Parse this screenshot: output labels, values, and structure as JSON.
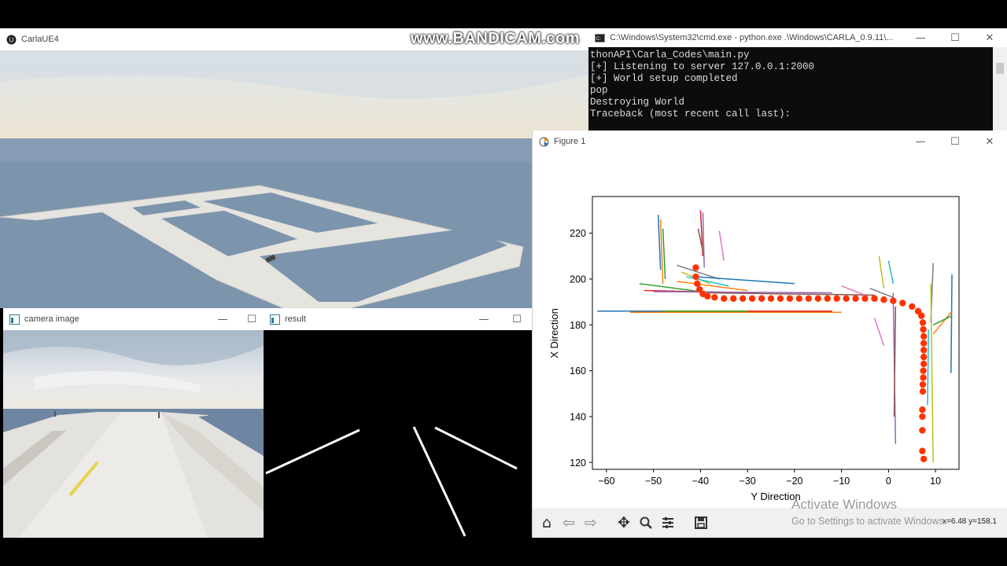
{
  "carla_window": {
    "title": "CarlaUE4",
    "minimize": "—",
    "maximize": "☐",
    "close": "✕"
  },
  "cmd_window": {
    "title": "C:\\Windows\\System32\\cmd.exe - python.exe  .\\Windows\\CARLA_0.9.11\\...",
    "minimize": "—",
    "maximize": "☐",
    "close": "✕",
    "lines": [
      "thonAPI\\Carla_Codes\\main.py",
      "[+] Listening to server 127.0.0.1:2000",
      "[+] World setup completed",
      "pop",
      "Destroying World",
      "Traceback (most recent call last):"
    ]
  },
  "camera_window": {
    "title": "camera image",
    "minimize": "—",
    "maximize": "☐"
  },
  "result_window": {
    "title": "result",
    "minimize": "—",
    "maximize": "☐"
  },
  "figure_window": {
    "title": "Figure 1",
    "minimize": "—",
    "maximize": "☐",
    "close": "✕",
    "toolbar": {
      "home": "home-icon",
      "back": "back-arrow-icon",
      "forward": "forward-arrow-icon",
      "pan": "pan-icon",
      "zoom": "zoom-icon",
      "configure": "configure-icon",
      "save": "save-icon"
    },
    "coords": "x=6.48 y=158.1"
  },
  "chart_data": {
    "type": "scatter",
    "title": "",
    "xlabel": "Y Direction",
    "ylabel": "X Direction",
    "xlim": [
      -63,
      15
    ],
    "ylim": [
      117,
      236
    ],
    "xticks": [
      -60,
      -50,
      -40,
      -30,
      -20,
      -10,
      0,
      10
    ],
    "yticks": [
      120,
      140,
      160,
      180,
      200,
      220
    ],
    "grid": false,
    "series": [
      {
        "marker_color": "#ff3300",
        "points": [
          [
            -41,
            205
          ],
          [
            -41,
            201
          ],
          [
            -40.7,
            198
          ],
          [
            -40.2,
            195.5
          ],
          [
            -39.5,
            193.5
          ],
          [
            -38.5,
            192.5
          ],
          [
            -37,
            192
          ],
          [
            -35,
            191.5
          ],
          [
            -33,
            191.5
          ],
          [
            -31,
            191.5
          ],
          [
            -29,
            191.5
          ],
          [
            -27,
            191.5
          ],
          [
            -25,
            191.5
          ],
          [
            -23,
            191.5
          ],
          [
            -21,
            191.5
          ],
          [
            -19,
            191.5
          ],
          [
            -17,
            191.5
          ],
          [
            -15,
            191.5
          ],
          [
            -13,
            191.5
          ],
          [
            -11,
            191.5
          ],
          [
            -9,
            191.5
          ],
          [
            -7,
            191.5
          ],
          [
            -5,
            191.5
          ],
          [
            -3,
            191.5
          ],
          [
            -1,
            191
          ],
          [
            1,
            190.5
          ],
          [
            3,
            189.5
          ],
          [
            5,
            188
          ],
          [
            6.3,
            186
          ],
          [
            7,
            184
          ],
          [
            7.3,
            181
          ],
          [
            7.4,
            178
          ],
          [
            7.5,
            175
          ],
          [
            7.5,
            172
          ],
          [
            7.5,
            169
          ],
          [
            7.5,
            166
          ],
          [
            7.5,
            163
          ],
          [
            7.4,
            160
          ],
          [
            7.4,
            157
          ],
          [
            7.3,
            154
          ],
          [
            7.3,
            151
          ],
          [
            7.2,
            143
          ],
          [
            7.2,
            140
          ],
          [
            7.2,
            134
          ],
          [
            7.2,
            125
          ],
          [
            7.5,
            121.5
          ]
        ]
      }
    ],
    "line_colors": [
      "#1f77b4",
      "#ff7f0e",
      "#2ca02c",
      "#d62728",
      "#9467bd",
      "#8c564b",
      "#e377c2",
      "#7f7f7f",
      "#bcbd22",
      "#17becf"
    ],
    "line_segments": [
      [
        [
          -49,
          228
        ],
        [
          -48.5,
          204
        ]
      ],
      [
        [
          -48.5,
          226
        ],
        [
          -48,
          198
        ]
      ],
      [
        [
          -48,
          222
        ],
        [
          -47.5,
          200
        ]
      ],
      [
        [
          -40,
          230
        ],
        [
          -39.5,
          210
        ]
      ],
      [
        [
          -39.5,
          229
        ],
        [
          -39.2,
          205
        ]
      ],
      [
        [
          -40.5,
          222
        ],
        [
          -39.5,
          212
        ]
      ],
      [
        [
          -36,
          221
        ],
        [
          -35,
          208
        ]
      ],
      [
        [
          -45,
          206
        ],
        [
          -36,
          200
        ]
      ],
      [
        [
          -44,
          203
        ],
        [
          -38,
          198
        ]
      ],
      [
        [
          -43,
          201
        ],
        [
          -34,
          197
        ]
      ],
      [
        [
          -41,
          201
        ],
        [
          -20,
          198
        ]
      ],
      [
        [
          -45,
          199
        ],
        [
          -30,
          195
        ]
      ],
      [
        [
          -53,
          198
        ],
        [
          -38,
          194
        ]
      ],
      [
        [
          -52,
          195
        ],
        [
          -30,
          194
        ]
      ],
      [
        [
          -50,
          194.5
        ],
        [
          -12,
          194
        ]
      ],
      [
        [
          -38,
          194
        ],
        [
          -3,
          193
        ]
      ],
      [
        [
          -10,
          197
        ],
        [
          -5,
          193
        ]
      ],
      [
        [
          -4,
          196
        ],
        [
          1,
          192
        ]
      ],
      [
        [
          -2,
          210
        ],
        [
          -1,
          196
        ]
      ],
      [
        [
          0,
          208
        ],
        [
          1,
          198
        ]
      ],
      [
        [
          -62,
          186
        ],
        [
          -40,
          186
        ]
      ],
      [
        [
          -55,
          185.5
        ],
        [
          -10,
          185.5
        ]
      ],
      [
        [
          -48,
          186
        ],
        [
          -27,
          186
        ]
      ],
      [
        [
          -30,
          186
        ],
        [
          -12,
          186
        ]
      ],
      [
        [
          1,
          194
        ],
        [
          1.5,
          128
        ]
      ],
      [
        [
          1.5,
          188
        ],
        [
          1.2,
          140
        ]
      ],
      [
        [
          -3,
          183
        ],
        [
          -1,
          171
        ]
      ],
      [
        [
          9.5,
          207
        ],
        [
          9,
          181
        ]
      ],
      [
        [
          9,
          198
        ],
        [
          9.5,
          120
        ]
      ],
      [
        [
          8.5,
          178
        ],
        [
          8.3,
          145
        ]
      ],
      [
        [
          13.5,
          202
        ],
        [
          13.3,
          159
        ]
      ],
      [
        [
          9.5,
          176
        ],
        [
          13.5,
          186
        ]
      ],
      [
        [
          9.5,
          180
        ],
        [
          13.5,
          184
        ]
      ]
    ]
  },
  "watermark": "www.BANDICAM.com",
  "activation": {
    "line1": "Activate Windows",
    "line2": "Go to Settings to activate Windows."
  }
}
